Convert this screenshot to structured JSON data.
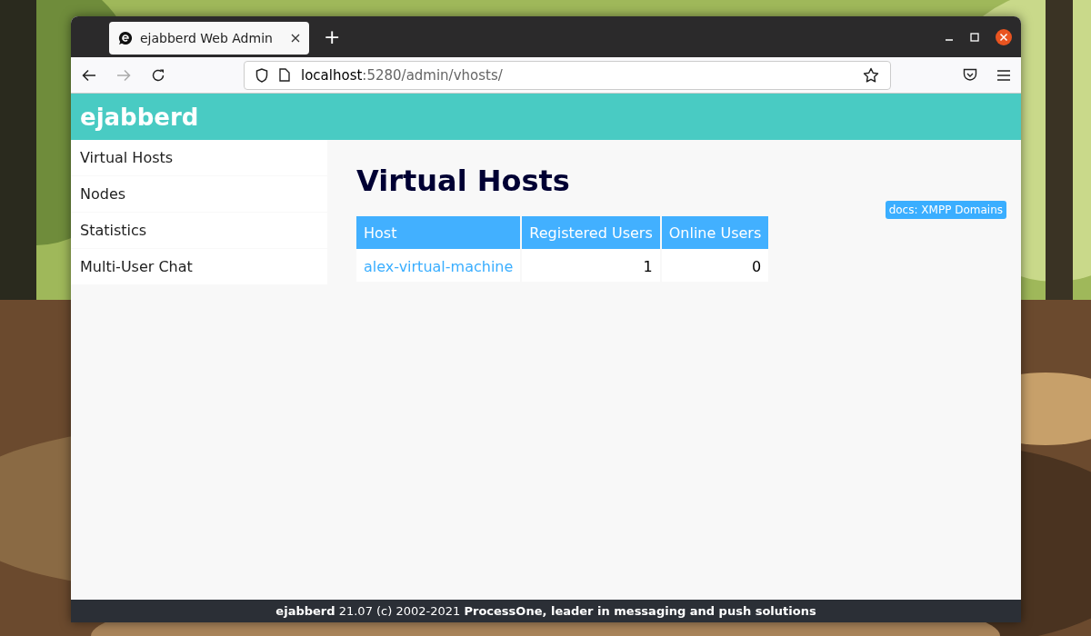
{
  "browser": {
    "tab": {
      "title": "ejabberd Web Admin",
      "selected": true
    },
    "new_tab": "+",
    "address": {
      "host": "localhost",
      "path": ":5280/admin/vhosts/"
    }
  },
  "header": {
    "logo": "ejabberd"
  },
  "sidebar": {
    "items": [
      {
        "label": "Virtual Hosts",
        "selected": false
      },
      {
        "label": "Nodes",
        "selected": false
      },
      {
        "label": "Statistics",
        "selected": false
      },
      {
        "label": "Multi-User Chat",
        "selected": false
      }
    ]
  },
  "main": {
    "title": "Virtual Hosts",
    "docs_link": "docs: XMPP Domains",
    "table": {
      "columns": [
        "Host",
        "Registered Users",
        "Online Users"
      ],
      "rows": [
        {
          "host": "alex-virtual-machine",
          "registered_users": "1",
          "online_users": "0"
        }
      ]
    }
  },
  "footer": "**ejabberd** 21.07 (c) 2002-2021 **ProcessOne, leader in messaging and push solutions**"
}
